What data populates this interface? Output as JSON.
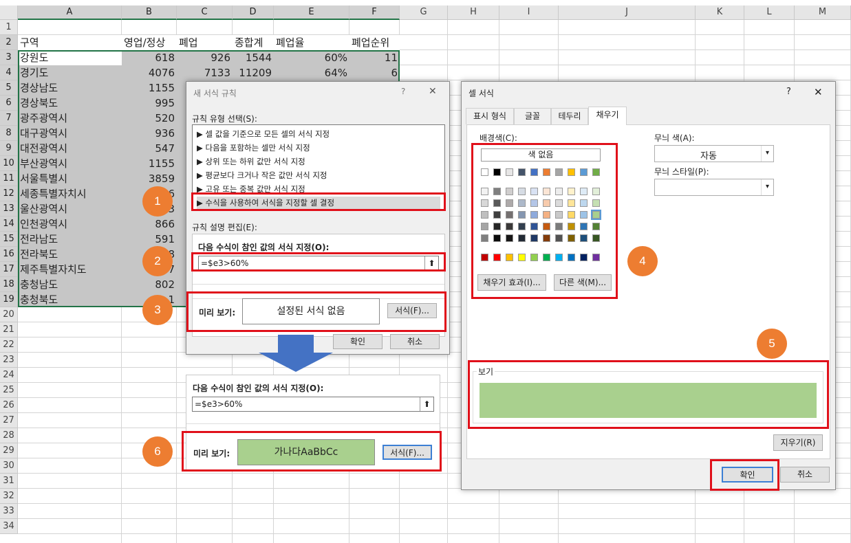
{
  "sheet": {
    "columns": [
      "A",
      "B",
      "C",
      "D",
      "E",
      "F",
      "G",
      "H",
      "I",
      "J",
      "K",
      "L",
      "M"
    ],
    "rows": [
      "1",
      "2",
      "3",
      "4",
      "5",
      "6",
      "7",
      "8",
      "9",
      "10",
      "11",
      "12",
      "13",
      "14",
      "15",
      "16",
      "17",
      "18",
      "19",
      "20",
      "21",
      "22",
      "23",
      "24",
      "25",
      "26",
      "27",
      "28",
      "29",
      "30",
      "31",
      "32",
      "33",
      "34"
    ],
    "headers": [
      "구역",
      "영업/정상",
      "폐업",
      "종합계",
      "폐업율",
      "폐업순위"
    ],
    "data": [
      [
        "강원도",
        "618",
        "926",
        "1544",
        "60%",
        "11"
      ],
      [
        "경기도",
        "4076",
        "7133",
        "11209",
        "64%",
        "6"
      ],
      [
        "경상남도",
        "1155",
        "",
        "",
        "",
        ""
      ],
      [
        "경상북도",
        "995",
        "",
        "",
        "",
        ""
      ],
      [
        "광주광역시",
        "520",
        "",
        "",
        "",
        ""
      ],
      [
        "대구광역시",
        "936",
        "",
        "",
        "",
        ""
      ],
      [
        "대전광역시",
        "547",
        "",
        "",
        "",
        ""
      ],
      [
        "부산광역시",
        "1155",
        "",
        "",
        "",
        ""
      ],
      [
        "서울특별시",
        "3859",
        "",
        "",
        "",
        ""
      ],
      [
        "세종특별자치시",
        "6",
        "",
        "",
        "",
        ""
      ],
      [
        "울산광역시",
        "3",
        "",
        "",
        "",
        ""
      ],
      [
        "인천광역시",
        "866",
        "",
        "",
        "",
        ""
      ],
      [
        "전라남도",
        "591",
        "",
        "",
        "",
        ""
      ],
      [
        "전라북도",
        "8",
        "",
        "",
        "",
        ""
      ],
      [
        "제주특별자치도",
        "7",
        "",
        "",
        "",
        ""
      ],
      [
        "충청남도",
        "802",
        "",
        "",
        "",
        ""
      ],
      [
        "충청북도",
        "1",
        "",
        "",
        "",
        ""
      ]
    ]
  },
  "rule_dialog": {
    "title": "새 서식 규칙",
    "help": "?",
    "close": "✕",
    "type_label": "규칙 유형 선택(S):",
    "rule_types": [
      "▶ 셀 값을 기준으로 모든 셀의 서식 지정",
      "▶ 다음을 포함하는 셀만 서식 지정",
      "▶ 상위 또는 하위 값만 서식 지정",
      "▶ 평균보다 크거나 작은 값만 서식 지정",
      "▶ 고유 또는 중복 값만 서식 지정",
      "▶ 수식을 사용하여 서식을 지정할 셀 결정"
    ],
    "edit_label": "규칙 설명 편집(E):",
    "formula_label": "다음 수식이 참인 값의 서식 지정(O):",
    "formula": "=$e3>60%",
    "preview_label": "미리 보기:",
    "preview_text": "설정된 서식 없음",
    "format_button": "서식(F)...",
    "ok": "확인",
    "cancel": "취소"
  },
  "result_panel": {
    "formula_label": "다음 수식이 참인 값의 서식 지정(O):",
    "formula": "=$e3>60%",
    "preview_label": "미리 보기:",
    "preview_text": "가나다AaBbCc",
    "format_button": "서식(F)..."
  },
  "format_dialog": {
    "title": "셀 서식",
    "help": "?",
    "close": "✕",
    "tabs": [
      "표시 형식",
      "글꼴",
      "테두리",
      "채우기"
    ],
    "bg_label": "배경색(C):",
    "no_color": "색 없음",
    "fill_effects": "채우기 효과(I)...",
    "more_colors": "다른 색(M)...",
    "pattern_color_label": "무늬 색(A):",
    "pattern_color_value": "자동",
    "pattern_style_label": "무늬 스타일(P):",
    "sample_label": "보기",
    "sample_color": "#a9d08e",
    "clear": "지우기(R)",
    "ok": "확인",
    "cancel": "취소"
  },
  "badges": [
    "1",
    "2",
    "3",
    "4",
    "5",
    "6"
  ],
  "colors": {
    "accent_red": "#e0101a",
    "badge": "#ed7d31",
    "arrow": "#4472c4",
    "selected_fill": "#a9d08e"
  }
}
